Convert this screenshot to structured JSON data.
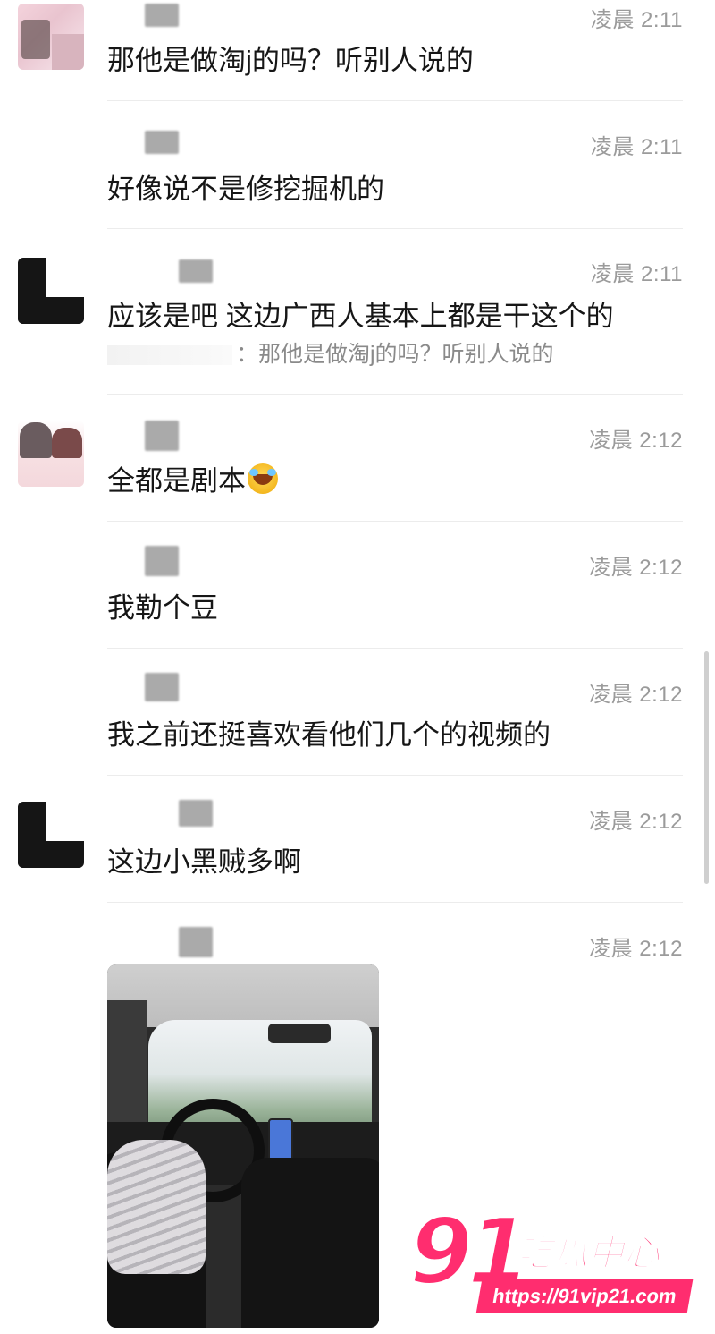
{
  "messages": [
    {
      "time": "凌晨 2:11",
      "text": "那他是做淘j的吗？听别人说的",
      "quote": ""
    },
    {
      "time": "凌晨 2:11",
      "text": "好像说不是修挖掘机的",
      "quote": ""
    },
    {
      "time": "凌晨 2:11",
      "text": "应该是吧 这边广西人基本上都是干这个的",
      "quote": "：那他是做淘j的吗？听别人说的"
    },
    {
      "time": "凌晨 2:12",
      "text": "全都是剧本",
      "quote": ""
    },
    {
      "time": "凌晨 2:12",
      "text": "我勒个豆",
      "quote": ""
    },
    {
      "time": "凌晨 2:12",
      "text": "我之前还挺喜欢看他们几个的视频的",
      "quote": ""
    },
    {
      "time": "凌晨 2:12",
      "text": "这边小黑贼多啊",
      "quote": ""
    },
    {
      "time": "凌晨 2:12",
      "text": "",
      "quote": ""
    }
  ],
  "watermark": {
    "number": "91",
    "brand": "吃瓜中心",
    "url": "https://91vip21.com"
  },
  "icons": [
    "crying-laughing-emoji-icon"
  ]
}
